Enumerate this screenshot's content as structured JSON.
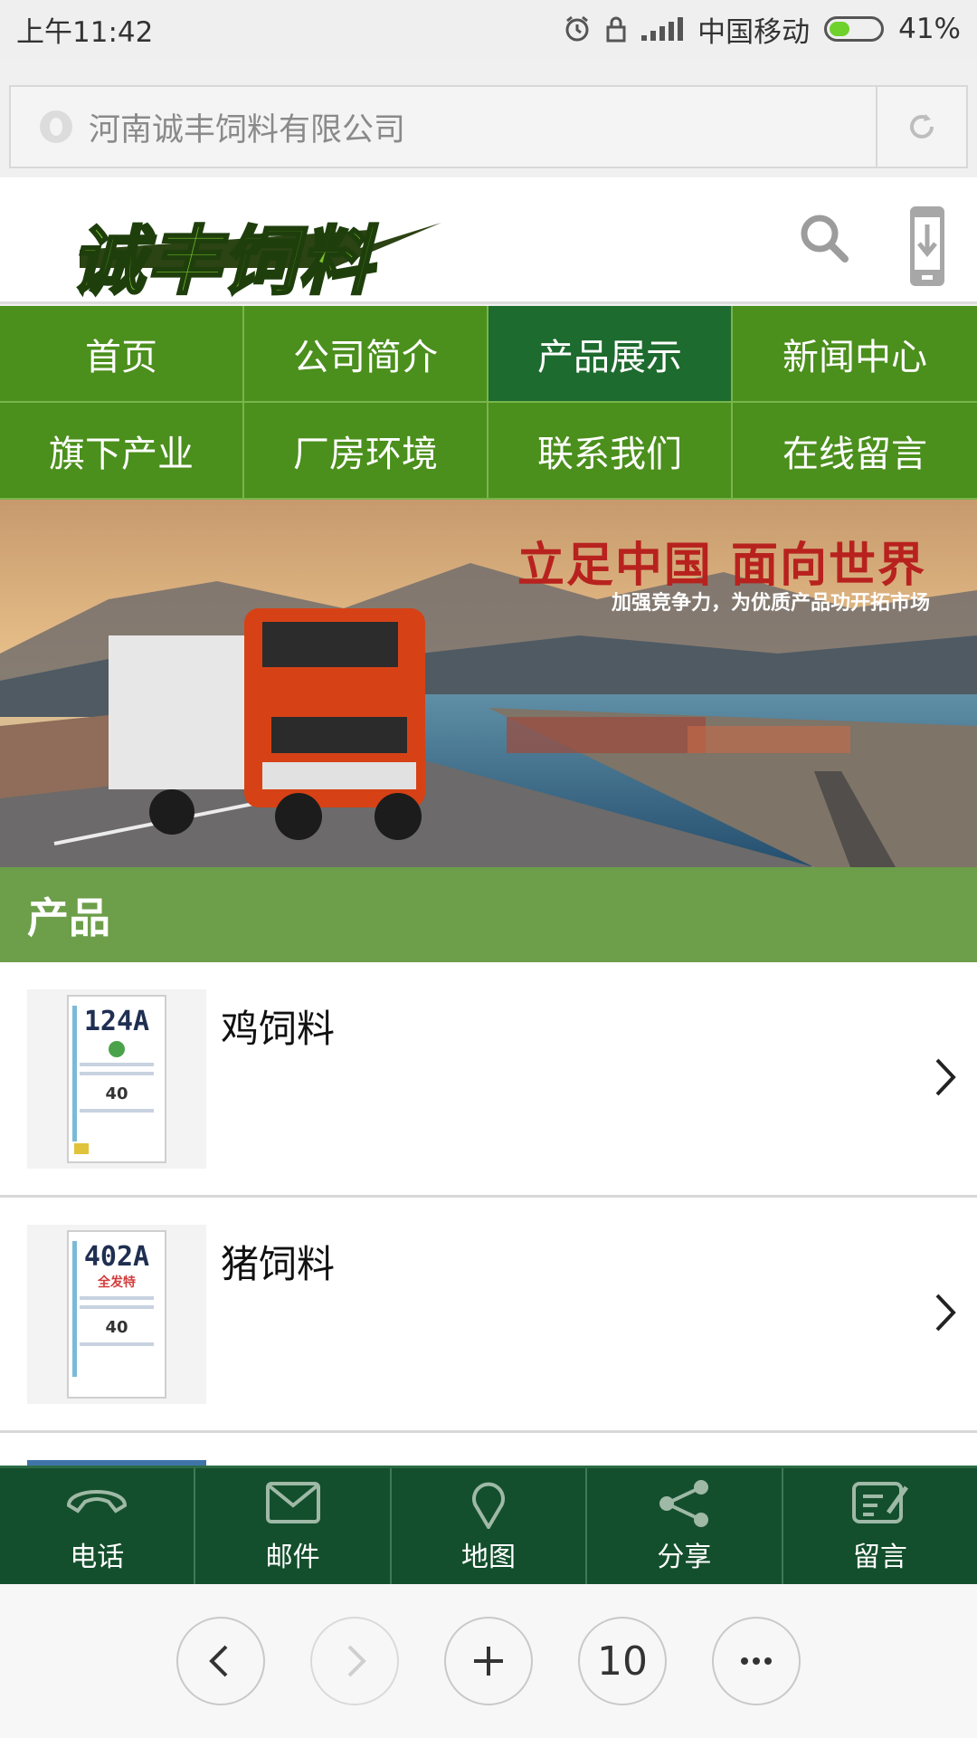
{
  "status_bar": {
    "time": "上午11:42",
    "carrier": "中国移动",
    "battery": "41%",
    "battery_level": 0.41
  },
  "url_bar": {
    "site_name": "河南诚丰饲料有限公司"
  },
  "header": {
    "logo_text": "诚丰饲料"
  },
  "nav": {
    "items": [
      {
        "label": "首页",
        "active": false
      },
      {
        "label": "公司简介",
        "active": false
      },
      {
        "label": "产品展示",
        "active": true
      },
      {
        "label": "新闻中心",
        "active": false
      },
      {
        "label": "旗下产业",
        "active": false
      },
      {
        "label": "厂房环境",
        "active": false
      },
      {
        "label": "联系我们",
        "active": false
      },
      {
        "label": "在线留言",
        "active": false
      }
    ]
  },
  "banner": {
    "headline": "立足中国  面向世界",
    "subline": "加强竞争力，为优质产品功开拓市场"
  },
  "section": {
    "title": "产品"
  },
  "products": [
    {
      "name": "鸡饲料",
      "code": "124A",
      "pack_number": "40"
    },
    {
      "name": "猪饲料",
      "code": "402A",
      "pack_number": "40",
      "brand": "全发特"
    }
  ],
  "actions": [
    {
      "label": "电话",
      "icon": "phone-icon"
    },
    {
      "label": "邮件",
      "icon": "mail-icon"
    },
    {
      "label": "地图",
      "icon": "map-pin-icon"
    },
    {
      "label": "分享",
      "icon": "share-icon"
    },
    {
      "label": "留言",
      "icon": "message-icon"
    }
  ],
  "browser_toolbar": {
    "tab_count": "10"
  },
  "colors": {
    "nav_green": "#4b8f1c",
    "nav_active": "#1d6b2e",
    "section_green": "#6d9e4a",
    "action_bar": "#144f2d"
  }
}
